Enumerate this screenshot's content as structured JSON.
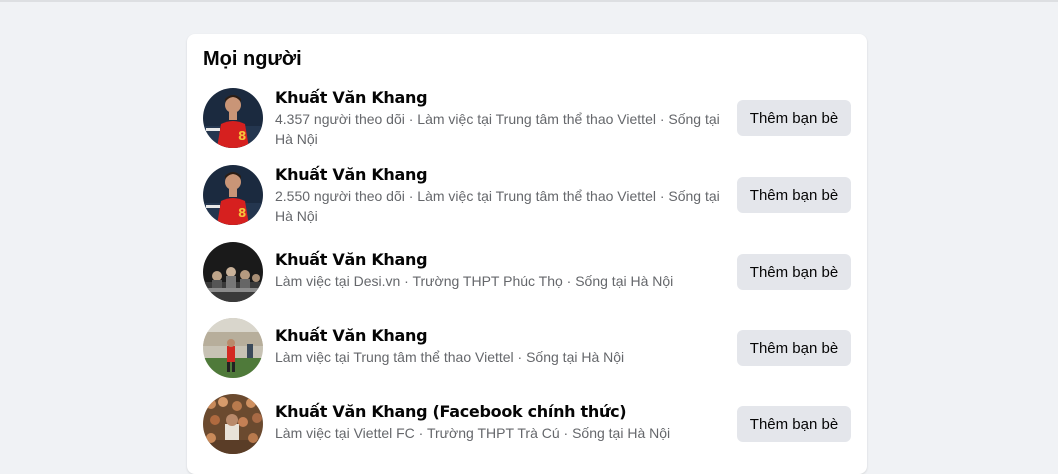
{
  "section_title": "Mọi người",
  "people": [
    {
      "name": "Khuất Văn Khang",
      "meta": "4.357 người theo dõi · Làm việc tại Trung tâm thể thao Viettel · Sống tại Hà Nội",
      "button": "Thêm bạn bè",
      "avatar": "player-red-jersey"
    },
    {
      "name": "Khuất Văn Khang",
      "meta": "2.550 người theo dõi · Làm việc tại Trung tâm thể thao Viettel · Sống tại Hà Nội",
      "button": "Thêm bạn bè",
      "avatar": "player-red-jersey"
    },
    {
      "name": "Khuất Văn Khang",
      "meta": "Làm việc tại Desi.vn · Trường THPT Phúc Thọ · Sống tại Hà Nội",
      "button": "Thêm bạn bè",
      "avatar": "group-photo"
    },
    {
      "name": "Khuất Văn Khang",
      "meta": "Làm việc tại Trung tâm thể thao Viettel · Sống tại Hà Nội",
      "button": "Thêm bạn bè",
      "avatar": "stadium-photo"
    },
    {
      "name": "Khuất Văn Khang (Facebook chính thức)",
      "meta": "Làm việc tại Viettel FC · Trường THPT Trà Cú · Sống tại Hà Nội",
      "button": "Thêm bạn bè",
      "avatar": "crowd-photo"
    }
  ]
}
